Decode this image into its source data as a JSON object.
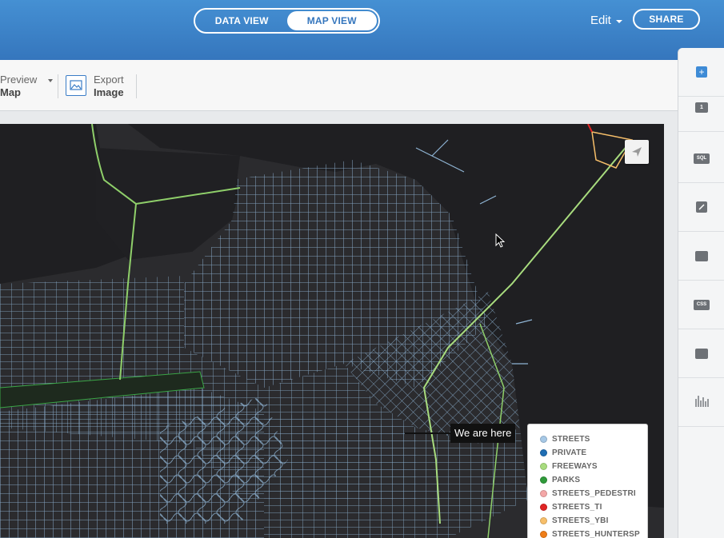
{
  "header": {
    "view_toggle": {
      "data_view": "DATA VIEW",
      "map_view": "MAP VIEW",
      "active": "map_view"
    },
    "edit_label": "Edit",
    "share_label": "SHARE",
    "colors": {
      "bar": "#3b7fc7",
      "accent": "#ffffff"
    }
  },
  "toolbar": {
    "preview": {
      "line1": "Preview",
      "line2": "Map"
    },
    "export": {
      "line1": "Export",
      "line2": "Image"
    }
  },
  "map": {
    "tooltip": "We are here",
    "send_icon": "paper-plane-icon",
    "legend": [
      {
        "label": "STREETS",
        "color": "#a6c8e6"
      },
      {
        "label": "PRIVATE",
        "color": "#1f6eb4"
      },
      {
        "label": "FREEWAYS",
        "color": "#a8dc7e"
      },
      {
        "label": "PARKS",
        "color": "#2f9a3a"
      },
      {
        "label": "STREETS_PEDESTRI",
        "color": "#f4a7a7"
      },
      {
        "label": "STREETS_TI",
        "color": "#e02424"
      },
      {
        "label": "STREETS_YBI",
        "color": "#f7bf6a"
      },
      {
        "label": "STREETS_HUNTERSP",
        "color": "#ef7d18"
      }
    ]
  },
  "sidebar": {
    "items": [
      {
        "icon": "add-layer-icon",
        "glyph": "+"
      },
      {
        "icon": "layer-1-icon",
        "glyph": "1"
      },
      {
        "icon": "sql-icon",
        "glyph": "SQL"
      },
      {
        "icon": "wizard-icon",
        "glyph": ""
      },
      {
        "icon": "infowindow-icon",
        "glyph": ""
      },
      {
        "icon": "css-icon",
        "glyph": "CSS"
      },
      {
        "icon": "legend-icon",
        "glyph": ""
      },
      {
        "icon": "filters-icon",
        "glyph": ""
      }
    ]
  }
}
